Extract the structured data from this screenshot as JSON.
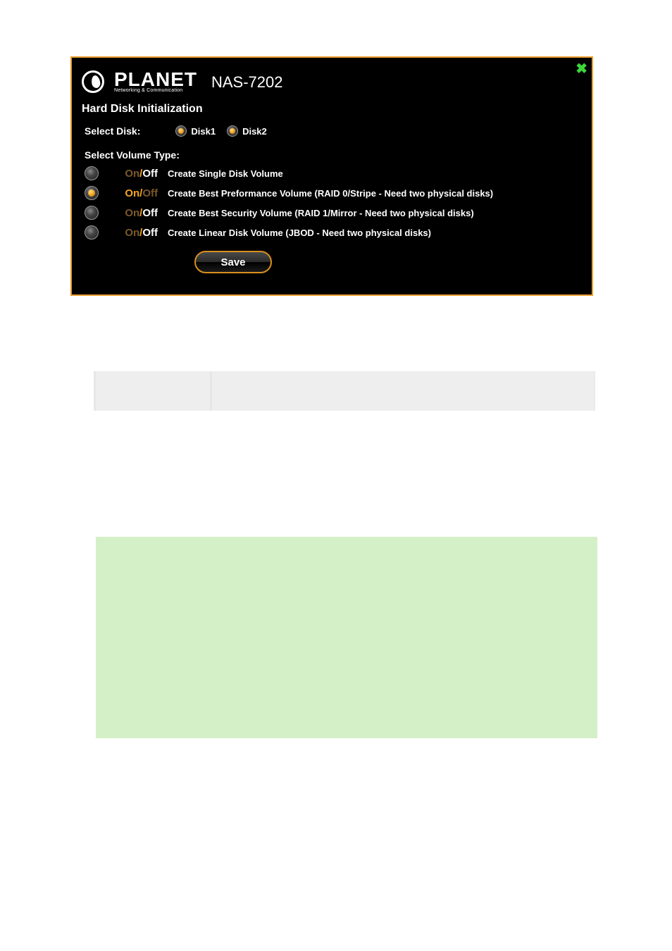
{
  "logo": {
    "name": "PLANET",
    "tagline": "Networking & Communication"
  },
  "model": "NAS-7202",
  "title": "Hard Disk Initialization",
  "selectDiskLabel": "Select Disk:",
  "disks": [
    {
      "label": "Disk1",
      "checked": true
    },
    {
      "label": "Disk2",
      "checked": true
    }
  ],
  "volumeTypeLabel": "Select Volume Type:",
  "volumeTypes": [
    {
      "on": false,
      "desc": "Create Single Disk Volume"
    },
    {
      "on": true,
      "desc": "Create Best Preformance Volume (RAID 0/Stripe - Need two physical disks)"
    },
    {
      "on": false,
      "desc": "Create Best Security Volume (RAID 1/Mirror - Need two physical disks)"
    },
    {
      "on": false,
      "desc": "Create Linear Disk Volume (JBOD - Need two physical disks)"
    }
  ],
  "onoff": {
    "on": "On",
    "off": "Off",
    "slash": "/"
  },
  "saveLabel": "Save"
}
